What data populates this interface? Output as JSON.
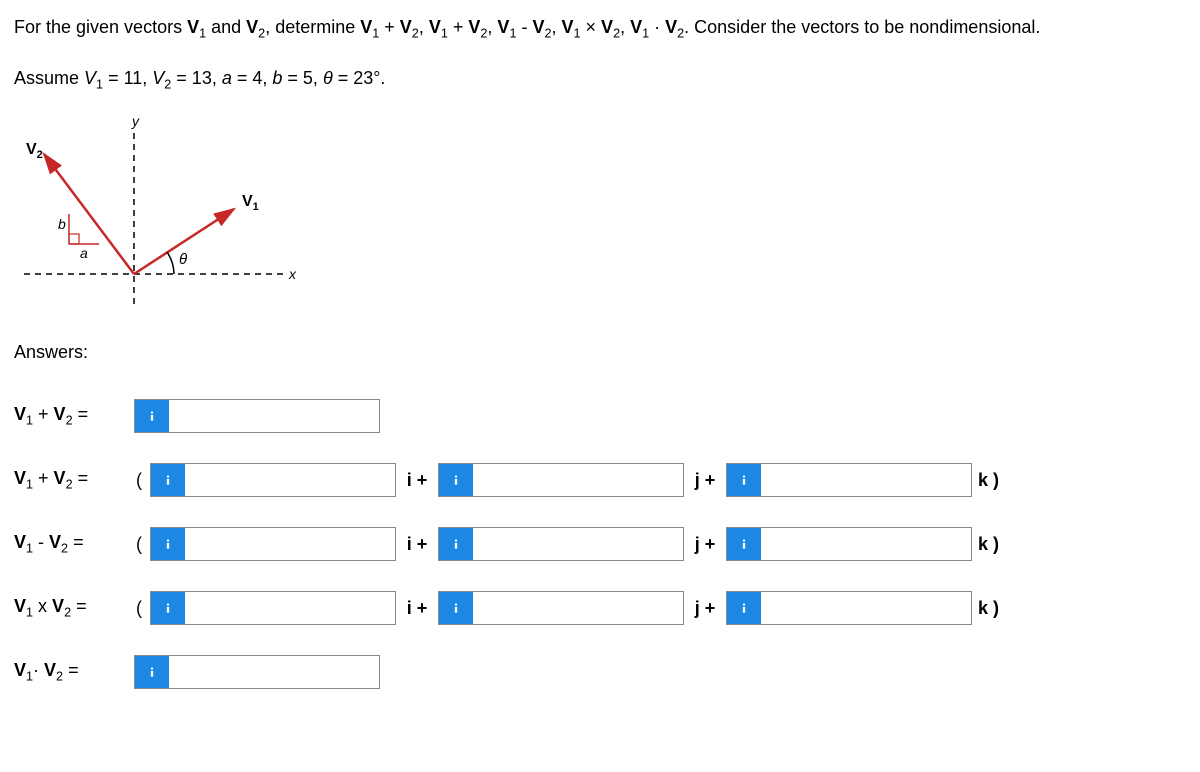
{
  "problem": {
    "line1_prefix": "For the given vectors ",
    "line1_mid1": " and ",
    "line1_mid2": ", determine ",
    "line1_suffix": ". Consider the vectors to be nondimensional.",
    "line2": "Assume V₁ = 11, V₂ = 13, a = 4, b = 5, θ = 23°."
  },
  "figure": {
    "V2": "V₂",
    "V1": "V₁",
    "a": "a",
    "b": "b",
    "theta": "θ",
    "x": "x",
    "y": "y"
  },
  "answers_label": "Answers:",
  "rows": {
    "r1": {
      "label_v": "V",
      "label_html_sub1": "1",
      "label_op": " + ",
      "label_sub2": "2",
      "label_eq": " ="
    },
    "r2": {
      "label": "V₁ + V₂ ="
    },
    "r3": {
      "label": "V₁ - V₂ ="
    },
    "r4": {
      "label": "V₁ x V₂ ="
    },
    "r5": {
      "label": "V₁· V₂ ="
    }
  },
  "units": {
    "i": "i +",
    "j": "j +",
    "k": "k )"
  },
  "paren_open": "("
}
